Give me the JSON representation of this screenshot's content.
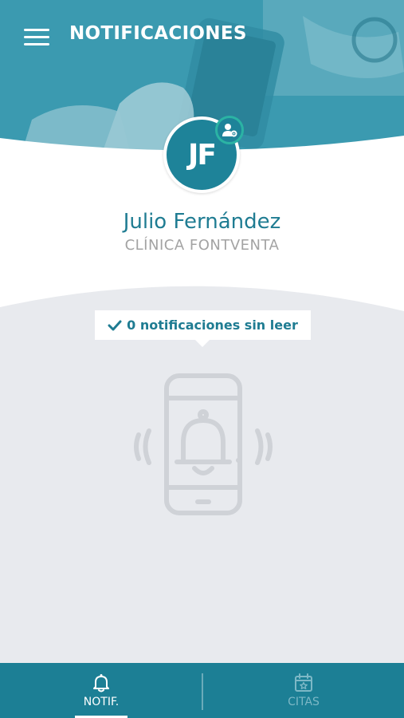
{
  "header": {
    "title": "NOTIFICACIONES",
    "menu_icon": "hamburger-menu-icon"
  },
  "profile": {
    "initials": "JF",
    "name": "Julio Fernández",
    "clinic": "CLÍNICA FONTVENTA",
    "badge_icon": "user-settings-icon"
  },
  "notifications": {
    "unread_label": "0 notificaciones sin leer",
    "check_icon": "check-icon",
    "empty_icon": "phone-bell-ringing-icon"
  },
  "bottom_nav": {
    "tabs": [
      {
        "label": "NOTIF.",
        "icon": "bell-icon",
        "active": true
      },
      {
        "label": "CITAS",
        "icon": "calendar-star-icon",
        "active": false
      }
    ]
  },
  "colors": {
    "primary": "#1c7f95",
    "accent": "#2bb3a4",
    "text_primary": "#1f7c92",
    "text_muted": "#a3a3a3",
    "content_bg": "#e8eaee"
  }
}
